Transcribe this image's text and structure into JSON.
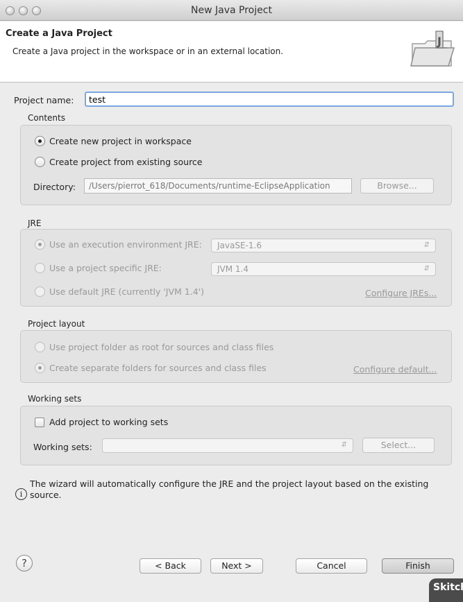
{
  "window": {
    "title": "New Java Project"
  },
  "header": {
    "title": "Create a Java Project",
    "description": "Create a Java project in the workspace or in an external location."
  },
  "project_name": {
    "label": "Project name:",
    "value": "test"
  },
  "contents": {
    "title": "Contents",
    "option_new": "Create new project in workspace",
    "option_existing": "Create project from existing source",
    "directory_label": "Directory:",
    "directory_value": "/Users/pierrot_618/Documents/runtime-EclipseApplication",
    "browse_label": "Browse..."
  },
  "jre": {
    "title": "JRE",
    "option_env": "Use an execution environment JRE:",
    "env_value": "JavaSE-1.6",
    "option_specific": "Use a project specific JRE:",
    "specific_value": "JVM 1.4",
    "option_default": "Use default JRE (currently 'JVM 1.4')",
    "configure_link": "Configure JREs..."
  },
  "layout": {
    "title": "Project layout",
    "option_root": "Use project folder as root for sources and class files",
    "option_separate": "Create separate folders for sources and class files",
    "configure_link": "Configure default..."
  },
  "working_sets": {
    "title": "Working sets",
    "add_label": "Add project to working sets",
    "sets_label": "Working sets:",
    "sets_value": "",
    "select_label": "Select..."
  },
  "info": {
    "icon": "info-icon",
    "text": "The wizard will automatically configure the JRE and the project layout based on the existing source."
  },
  "footer": {
    "help_glyph": "?",
    "back_label": "< Back",
    "next_label": "Next >",
    "cancel_label": "Cancel",
    "finish_label": "Finish"
  },
  "watermark": "Skitch"
}
